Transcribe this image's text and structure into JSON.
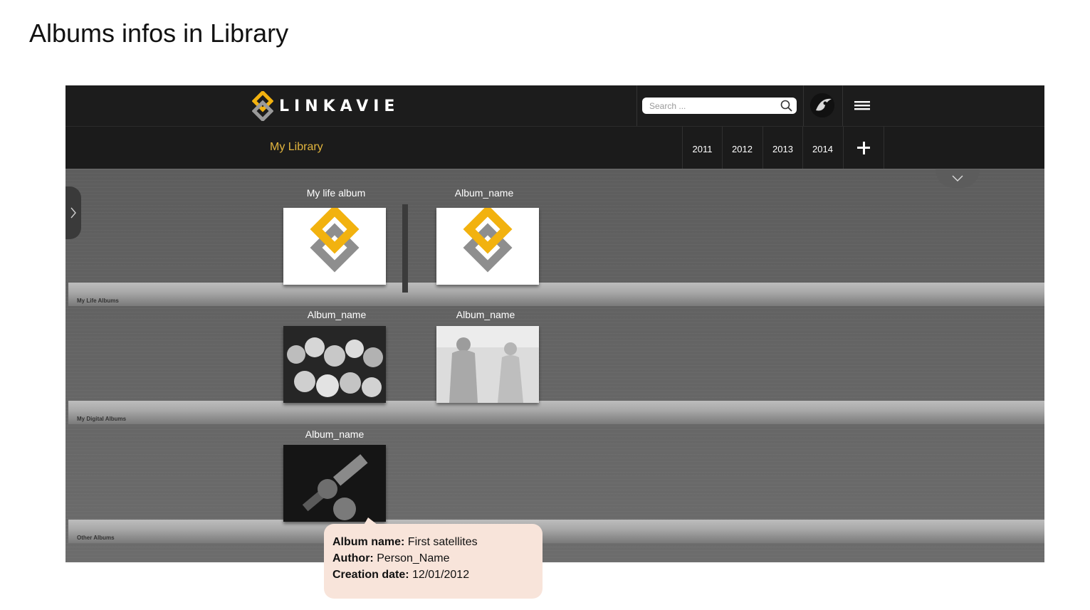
{
  "document": {
    "heading": "Albums infos in Library"
  },
  "header": {
    "logo_text": "LINKAVIE",
    "search_placeholder": "Search ...",
    "search_value": ""
  },
  "subnav": {
    "section": "My Library",
    "years": [
      "2011",
      "2012",
      "2013",
      "2014"
    ],
    "add_icon": "plus-icon"
  },
  "shelves": [
    {
      "label": "My Life Albums",
      "albums": [
        {
          "title": "My life album",
          "cover": "linkavie-logo"
        },
        {
          "title": "Album_name",
          "cover": "linkavie-logo"
        }
      ]
    },
    {
      "label": "My Digital Albums",
      "albums": [
        {
          "title": "Album_name",
          "cover": "crowd-photo"
        },
        {
          "title": "Album_name",
          "cover": "couple-photo"
        }
      ]
    },
    {
      "label": "Other Albums",
      "albums": [
        {
          "title": "Album_name",
          "cover": "satellite-photo"
        }
      ]
    }
  ],
  "tooltip": {
    "name_key": "Album name:",
    "name_value": " First satellites",
    "author_key": "Author:",
    "author_value": " Person_Name",
    "date_key": "Creation date:",
    "date_value": " 12/01/2012"
  },
  "colors": {
    "accent": "#e2b53e",
    "bar": "#1c1c1c",
    "tooltip_bg": "#f8e4da"
  }
}
